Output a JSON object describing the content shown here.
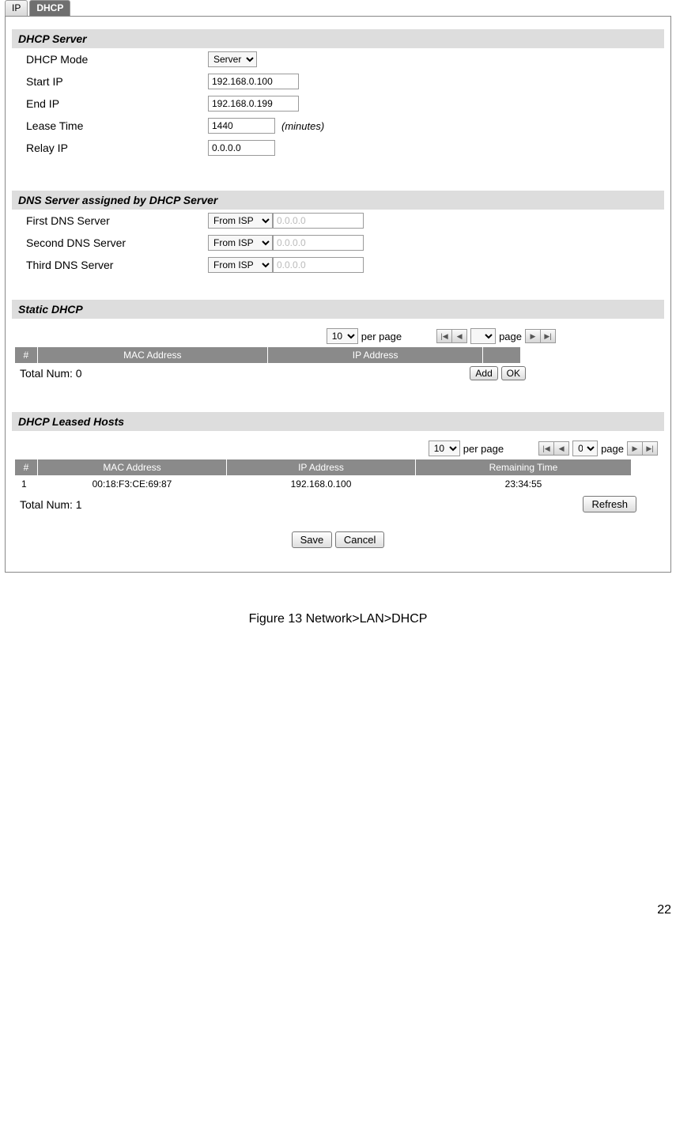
{
  "tabs": {
    "ip": "IP",
    "dhcp": "DHCP"
  },
  "dhcp_server": {
    "title": "DHCP Server",
    "mode_label": "DHCP Mode",
    "mode_value": "Server",
    "start_ip_label": "Start IP",
    "start_ip_value": "192.168.0.100",
    "end_ip_label": "End IP",
    "end_ip_value": "192.168.0.199",
    "lease_time_label": "Lease Time",
    "lease_time_value": "1440",
    "lease_time_unit": "(minutes)",
    "relay_ip_label": "Relay IP",
    "relay_ip_value": "0.0.0.0"
  },
  "dns": {
    "title": "DNS Server assigned by DHCP Server",
    "rows": [
      {
        "label": "First DNS Server",
        "mode": "From ISP",
        "ip": "0.0.0.0"
      },
      {
        "label": "Second DNS Server",
        "mode": "From ISP",
        "ip": "0.0.0.0"
      },
      {
        "label": "Third DNS Server",
        "mode": "From ISP",
        "ip": "0.0.0.0"
      }
    ]
  },
  "static_dhcp": {
    "title": "Static DHCP",
    "per_page_value": "10",
    "per_page_label": "per page",
    "page_label": "page",
    "headers": {
      "num": "#",
      "mac": "MAC Address",
      "ip": "IP Address"
    },
    "total_label": "Total Num: 0",
    "add_btn": "Add",
    "ok_btn": "OK"
  },
  "leased": {
    "title": "DHCP Leased Hosts",
    "per_page_value": "10",
    "per_page_label": "per page",
    "page_value": "0",
    "page_label": "page",
    "headers": {
      "num": "#",
      "mac": "MAC Address",
      "ip": "IP Address",
      "remain": "Remaining Time"
    },
    "rows": [
      {
        "num": "1",
        "mac": "00:18:F3:CE:69:87",
        "ip": "192.168.0.100",
        "remain": "23:34:55"
      }
    ],
    "total_label": "Total Num: 1",
    "refresh_btn": "Refresh"
  },
  "buttons": {
    "save": "Save",
    "cancel": "Cancel"
  },
  "caption": "Figure 13  Network>LAN>DHCP",
  "page_number": "22"
}
